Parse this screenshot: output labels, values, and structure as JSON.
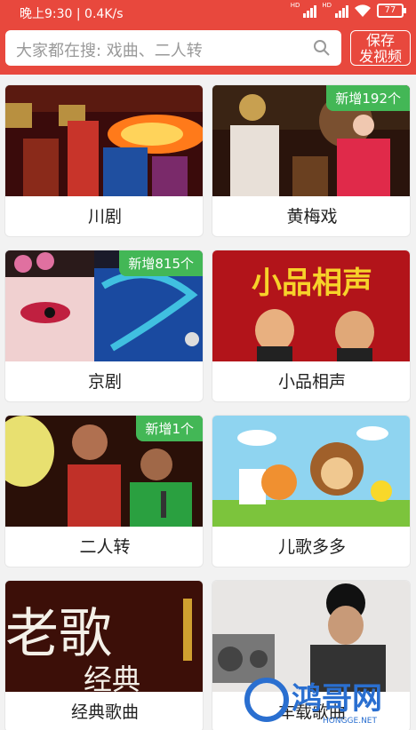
{
  "status_bar": {
    "time": "晚上9:30 | 0.4K/s",
    "battery": "77"
  },
  "search": {
    "placeholder": "大家都在搜: 戏曲、二人转"
  },
  "save_button": {
    "line1": "保存",
    "line2": "发视频"
  },
  "categories": [
    {
      "label": "川剧",
      "badge": ""
    },
    {
      "label": "黄梅戏",
      "badge": "新增192个"
    },
    {
      "label": "京剧",
      "badge": "新增815个"
    },
    {
      "label": "小品相声",
      "badge": "",
      "thumb_text": "小品相声"
    },
    {
      "label": "二人转",
      "badge": "新增1个"
    },
    {
      "label": "儿歌多多",
      "badge": ""
    },
    {
      "label": "经典歌曲",
      "badge": "",
      "thumb_text_main": "老歌",
      "thumb_text_sub": "经典"
    },
    {
      "label": "车载歌曲",
      "badge": ""
    }
  ],
  "watermark": {
    "text": "鸿哥网",
    "sub": "HONGGE.NET"
  },
  "colors": {
    "header": "#e8483d",
    "badge": "#43b756"
  }
}
